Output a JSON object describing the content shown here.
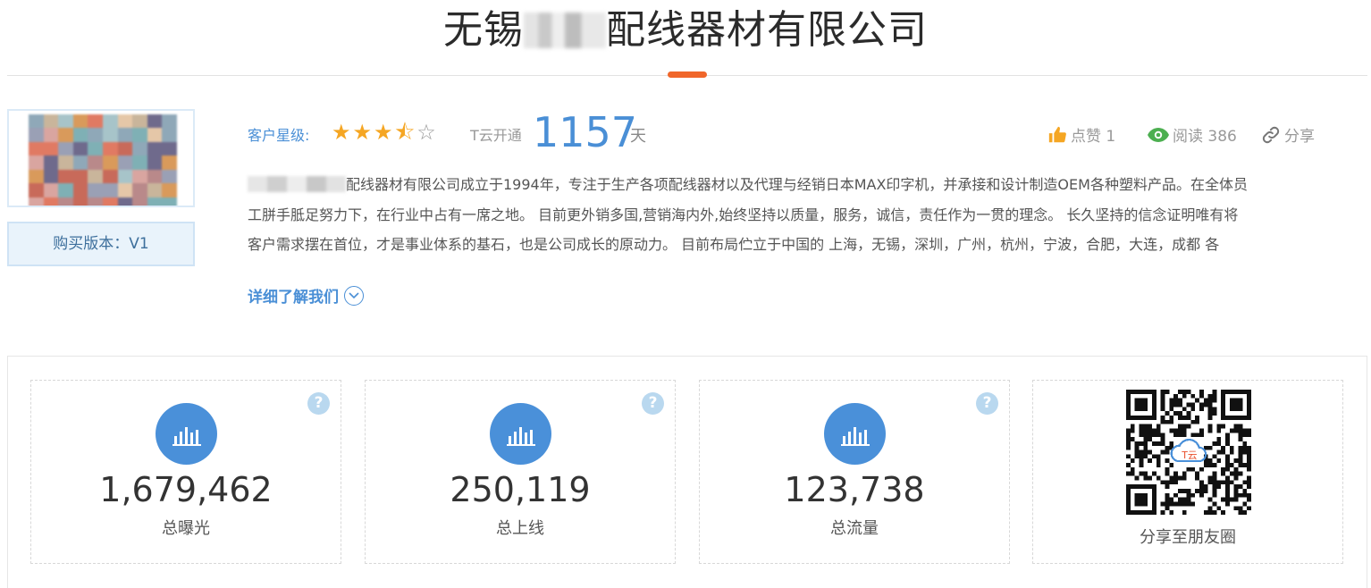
{
  "company": {
    "title_prefix": "无锡",
    "title_suffix": "配线器材有限公司"
  },
  "profile": {
    "version_label": "购买版本：V1"
  },
  "meta": {
    "rating_label": "客户星级:",
    "rating_stars": 3.5,
    "open_label": "T云开通",
    "open_days": "1157",
    "days_unit": "天",
    "likes_label": "点赞 1",
    "reads_label": "阅读 386",
    "share_label": "分享"
  },
  "description": {
    "line1_after_blur": "配线器材有限公司成立于1994年，专注于生产各项配线器材以及代理与经销日本MAX印字机，并承接和设计制造OEM各种塑料产品。在全体员",
    "line2": "工胼手胝足努力下，在行业中占有一席之地。 目前更外销多国,营销海内外,始终坚持以质量，服务，诚信，责任作为一贯的理念。 长久坚持的信念证明唯有将",
    "line3": "客户需求摆在首位，才是事业体系的基石，也是公司成长的原动力。 目前布局伫立于中国的 上海，无锡，深圳，广州，杭州，宁波，合肥，大连，成都 各",
    "more_label": "详细了解我们"
  },
  "stats": [
    {
      "value": "1,679,462",
      "label": "总曝光"
    },
    {
      "value": "250,119",
      "label": "总上线"
    },
    {
      "value": "123,738",
      "label": "总流量"
    }
  ],
  "qr": {
    "caption": "分享至朋友圈",
    "center_text": "T云"
  },
  "colors": {
    "accent_blue": "#4a8fd6",
    "accent_orange": "#f0662a",
    "star": "#f5a623",
    "like_icon": "#f5a623",
    "read_icon": "#4caf50"
  }
}
